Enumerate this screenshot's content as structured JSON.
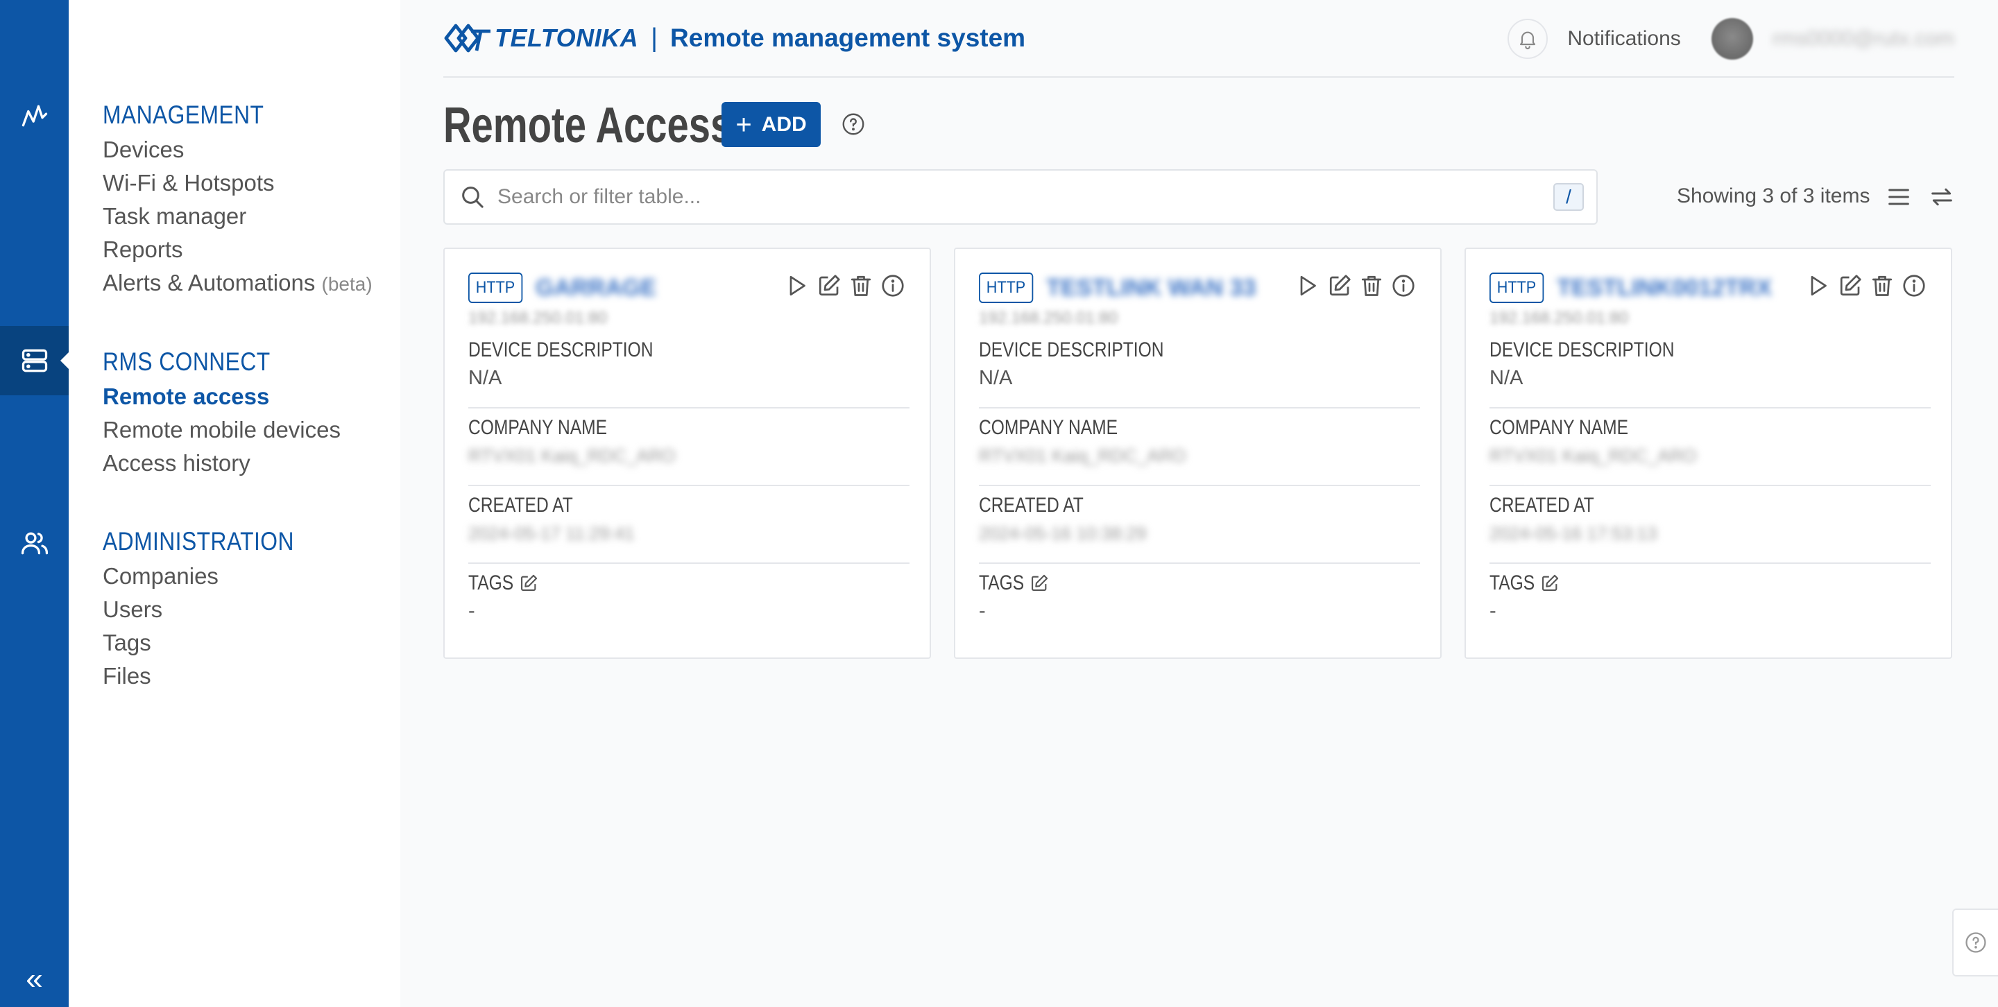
{
  "colors": {
    "brand": "#0d56a6",
    "rail_active": "#08437f",
    "page_bg": "#f9fafb"
  },
  "rail": {
    "items": [
      {
        "icon": "activity-icon"
      },
      {
        "icon": "server-icon",
        "active": true
      },
      {
        "icon": "users-icon"
      }
    ],
    "collapse_label": "«"
  },
  "nav": {
    "management": {
      "heading": "MANAGEMENT",
      "items": [
        "Devices",
        "Wi-Fi & Hotspots",
        "Task manager",
        "Reports",
        "Alerts & Automations"
      ],
      "beta": "(beta)"
    },
    "rms_connect": {
      "heading": "RMS CONNECT",
      "items": [
        "Remote access",
        "Remote mobile devices",
        "Access history"
      ]
    },
    "administration": {
      "heading": "ADMINISTRATION",
      "items": [
        "Companies",
        "Users",
        "Tags",
        "Files"
      ]
    }
  },
  "header": {
    "brand": "TELTONIKA",
    "separator": "|",
    "title": "Remote management system",
    "notifications": "Notifications",
    "user_email": "rms0000@rutx.com"
  },
  "page": {
    "title": "Remote Access",
    "add_label": "ADD",
    "search_placeholder": "Search or filter table...",
    "search_shortcut": "/",
    "showing": "Showing 3 of 3 items"
  },
  "cards": [
    {
      "protocol": "HTTP",
      "name": "GARRAGE",
      "ip": "192.168.250.01:80",
      "labels": {
        "desc": "DEVICE DESCRIPTION",
        "company": "COMPANY NAME",
        "created": "CREATED AT",
        "tags": "TAGS"
      },
      "description": "N/A",
      "company": "RTVX01 Kaiq_RDC_ARO",
      "created_at": "2024-05-17 11:29:41",
      "tags": "-"
    },
    {
      "protocol": "HTTP",
      "name": "TESTLINK WAN 33",
      "ip": "192.168.250.01:80",
      "labels": {
        "desc": "DEVICE DESCRIPTION",
        "company": "COMPANY NAME",
        "created": "CREATED AT",
        "tags": "TAGS"
      },
      "description": "N/A",
      "company": "RTVX01 Kaiq_RDC_ARO",
      "created_at": "2024-05-16 10:38:29",
      "tags": "-"
    },
    {
      "protocol": "HTTP",
      "name": "TESTLINK0012TRX",
      "ip": "192.168.250.01:80",
      "labels": {
        "desc": "DEVICE DESCRIPTION",
        "company": "COMPANY NAME",
        "created": "CREATED AT",
        "tags": "TAGS"
      },
      "description": "N/A",
      "company": "RTVX01 Kaiq_RDC_ARO",
      "created_at": "2024-05-16 17:53:13",
      "tags": "-"
    }
  ]
}
